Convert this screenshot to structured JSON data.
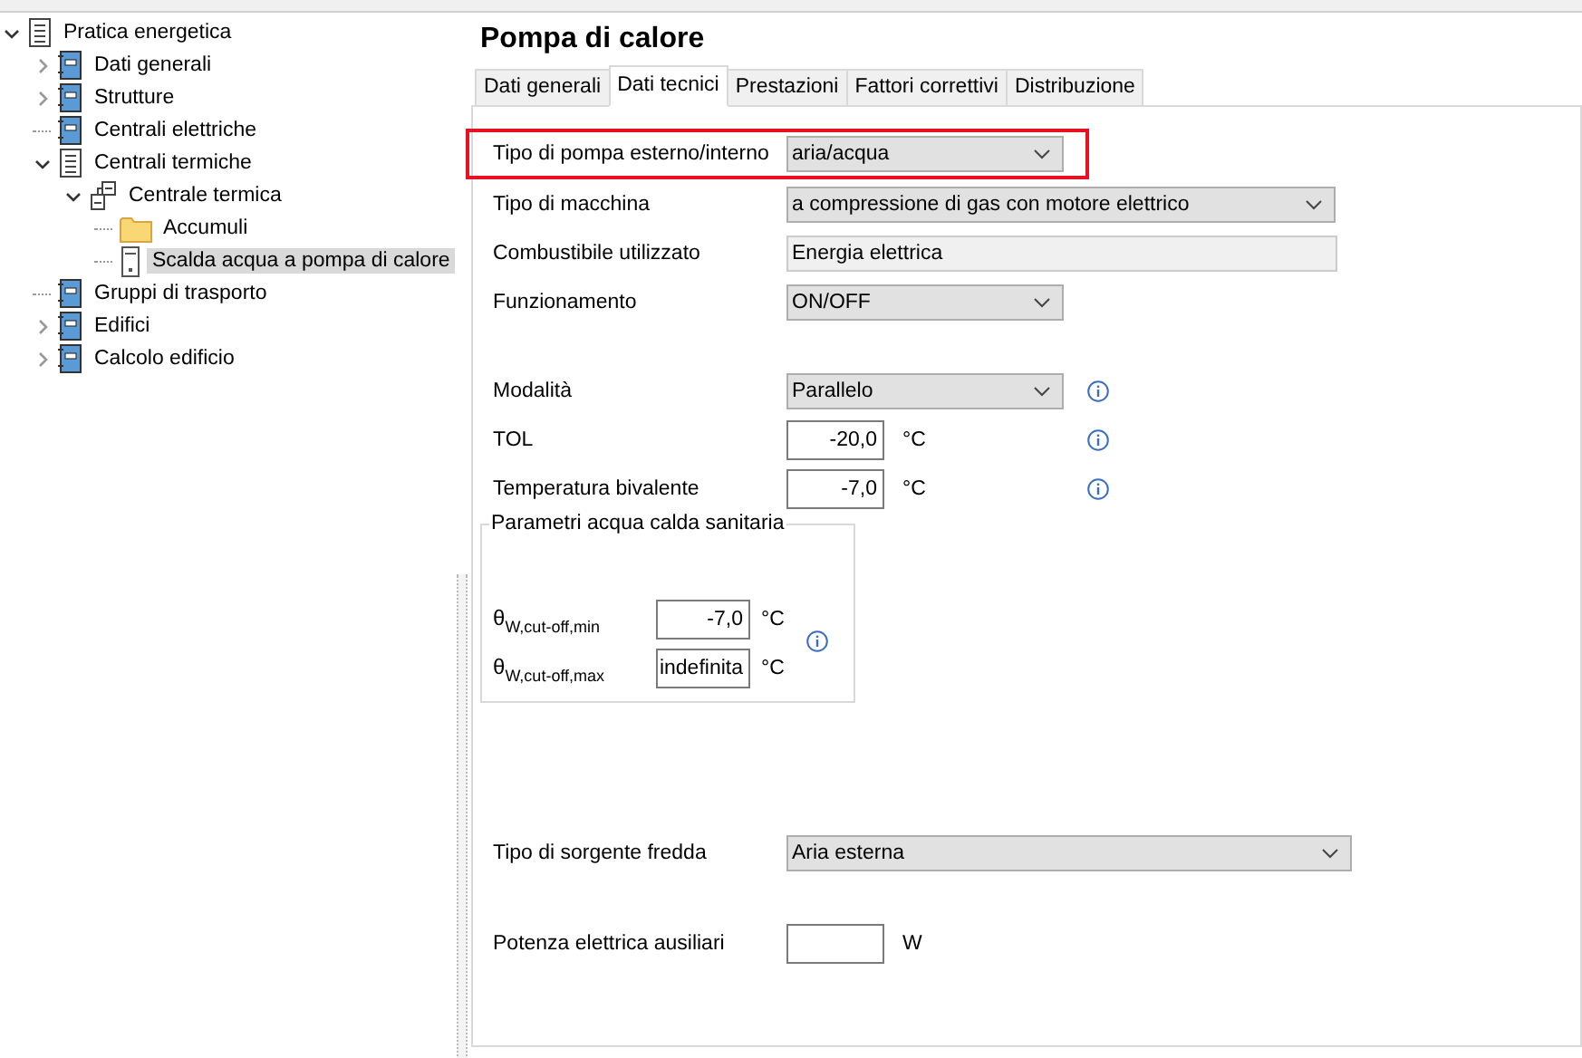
{
  "tree": [
    {
      "label": "Pratica energetica",
      "kind": "document",
      "expandable": true,
      "expanded": true,
      "selected": false,
      "children": [
        {
          "label": "Dati generali",
          "kind": "module",
          "expandable": true,
          "expanded": false,
          "selected": false
        },
        {
          "label": "Strutture",
          "kind": "module",
          "expandable": true,
          "expanded": false,
          "selected": false
        },
        {
          "label": "Centrali elettriche",
          "kind": "module",
          "expandable": false,
          "selected": false
        },
        {
          "label": "Centrali termiche",
          "kind": "document",
          "expandable": true,
          "expanded": true,
          "selected": false,
          "children": [
            {
              "label": "Centrale termica",
              "kind": "network",
              "expandable": true,
              "expanded": true,
              "selected": false,
              "children": [
                {
                  "label": "Accumuli",
                  "kind": "folder",
                  "expandable": false,
                  "selected": false
                },
                {
                  "label": "Scalda acqua a pompa di calore",
                  "kind": "device",
                  "expandable": false,
                  "selected": true
                }
              ]
            }
          ]
        },
        {
          "label": "Gruppi di trasporto",
          "kind": "module",
          "expandable": false,
          "selected": false
        },
        {
          "label": "Edifici",
          "kind": "module",
          "expandable": true,
          "expanded": false,
          "selected": false
        },
        {
          "label": "Calcolo edificio",
          "kind": "module",
          "expandable": true,
          "expanded": false,
          "selected": false
        }
      ]
    }
  ],
  "panel": {
    "title": "Pompa di calore",
    "tabs": [
      {
        "label": "Dati generali",
        "selected": false
      },
      {
        "label": "Dati tecnici",
        "selected": true
      },
      {
        "label": "Prestazioni",
        "selected": false
      },
      {
        "label": "Fattori correttivi",
        "selected": false
      },
      {
        "label": "Distribuzione",
        "selected": false
      }
    ],
    "sections": [
      {
        "kind": "rows",
        "rows": [
          {
            "label": "Tipo di pompa esterno/interno",
            "kind": "select",
            "value": "aria/acqua",
            "highlighted": true,
            "info": false
          },
          {
            "label": "Tipo di macchina",
            "kind": "select",
            "value": "a compressione di gas con motore elettrico",
            "highlighted": false,
            "info": false
          },
          {
            "label": "Combustibile utilizzato",
            "kind": "readonly",
            "value": "Energia elettrica",
            "highlighted": false,
            "info": false
          },
          {
            "label": "Funzionamento",
            "kind": "select",
            "value": "ON/OFF",
            "highlighted": false,
            "info": false
          }
        ]
      },
      {
        "kind": "rows",
        "rows": [
          {
            "label": "Modalità",
            "kind": "select",
            "value": "Parallelo",
            "highlighted": false,
            "info": true
          },
          {
            "label": "TOL",
            "kind": "number",
            "value": "-20,0",
            "unit": "°C",
            "highlighted": false,
            "info": true
          },
          {
            "label": "Temperatura bivalente",
            "kind": "number",
            "value": "-7,0",
            "unit": "°C",
            "highlighted": false,
            "info": true
          }
        ]
      },
      {
        "kind": "group",
        "title": "Parametri acqua calda sanitaria",
        "info": true,
        "rows": [
          {
            "label": "θ$_{W,cut-off,min}$",
            "value": "-7,0",
            "unit": "°C"
          },
          {
            "label": "θ$_{W,cut-off,max}$",
            "value": "indefinita",
            "unit": "°C"
          }
        ]
      },
      {
        "kind": "rows",
        "rows": [
          {
            "label": "Tipo di sorgente fredda",
            "kind": "select",
            "value": "Aria esterna",
            "highlighted": false,
            "info": false
          }
        ]
      },
      {
        "kind": "rows",
        "rows": [
          {
            "label": "Potenza elettrica ausiliari",
            "kind": "number",
            "unit": "W",
            "highlighted": false,
            "info": false
          }
        ]
      }
    ]
  }
}
